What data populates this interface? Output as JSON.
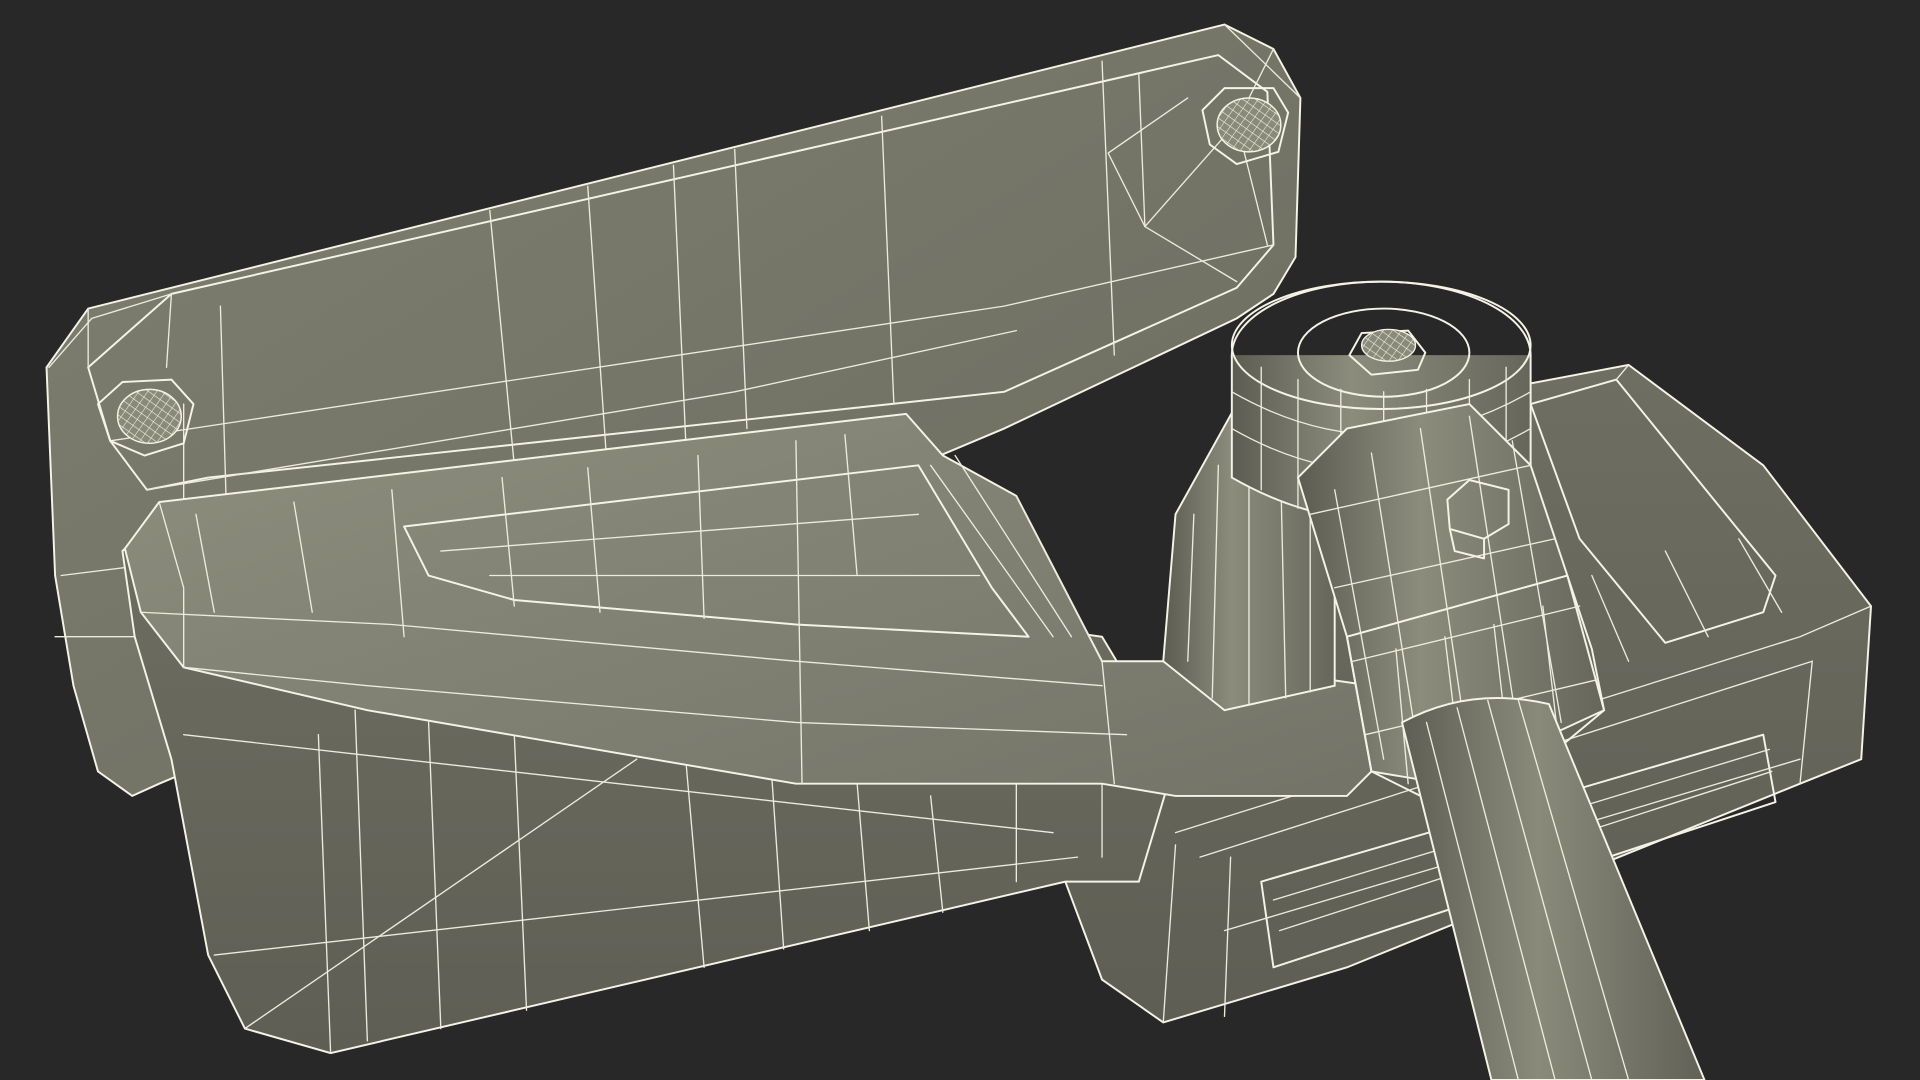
{
  "scene": {
    "description_free": true,
    "background_color": "#282828",
    "surface_color": "#7a7a6c",
    "surface_light": "#8d8d7d",
    "surface_dark": "#55554b",
    "wire_color": "#ecebdc"
  }
}
